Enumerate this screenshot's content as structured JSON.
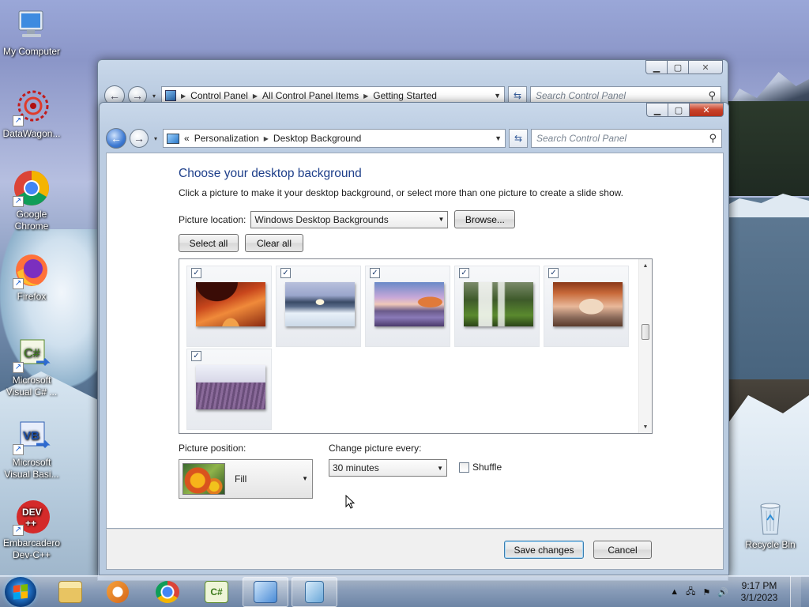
{
  "desktop": {
    "icons": [
      {
        "label": "My Computer"
      },
      {
        "label": "DataWagon..."
      },
      {
        "label": "Google Chrome"
      },
      {
        "label": "Firefox"
      },
      {
        "label": "Microsoft Visual C# ..."
      },
      {
        "label": "Microsoft Visual Basi..."
      },
      {
        "label": "Embarcadero Dev-C++"
      },
      {
        "label": "Recycle Bin"
      }
    ]
  },
  "back_window": {
    "breadcrumb": [
      "Control Panel",
      "All Control Panel Items",
      "Getting Started"
    ],
    "search_placeholder": "Search Control Panel"
  },
  "window": {
    "breadcrumb_prefix": "«",
    "breadcrumb": [
      "Personalization",
      "Desktop Background"
    ],
    "search_placeholder": "Search Control Panel",
    "title": "Choose your desktop background",
    "description": "Click a picture to make it your desktop background, or select more than one picture to create a slide show.",
    "picture_location_label": "Picture location:",
    "picture_location_value": "Windows Desktop Backgrounds",
    "browse_label": "Browse...",
    "select_all_label": "Select all",
    "clear_all_label": "Clear all",
    "pictures": [
      {
        "name": "canyon-red",
        "checked": true
      },
      {
        "name": "ice-lake",
        "checked": true
      },
      {
        "name": "sunset-coast",
        "checked": true
      },
      {
        "name": "waterfall-forest",
        "checked": true
      },
      {
        "name": "rock-arch",
        "checked": true
      },
      {
        "name": "lavender-field",
        "checked": true
      }
    ],
    "check_glyph": "✓",
    "picture_position_label": "Picture position:",
    "picture_position_value": "Fill",
    "change_every_label": "Change picture every:",
    "change_every_value": "30 minutes",
    "shuffle_label": "Shuffle",
    "shuffle_checked": false,
    "save_label": "Save changes",
    "cancel_label": "Cancel"
  },
  "taskbar": {
    "time": "9:17 PM",
    "date": "3/1/2023"
  }
}
